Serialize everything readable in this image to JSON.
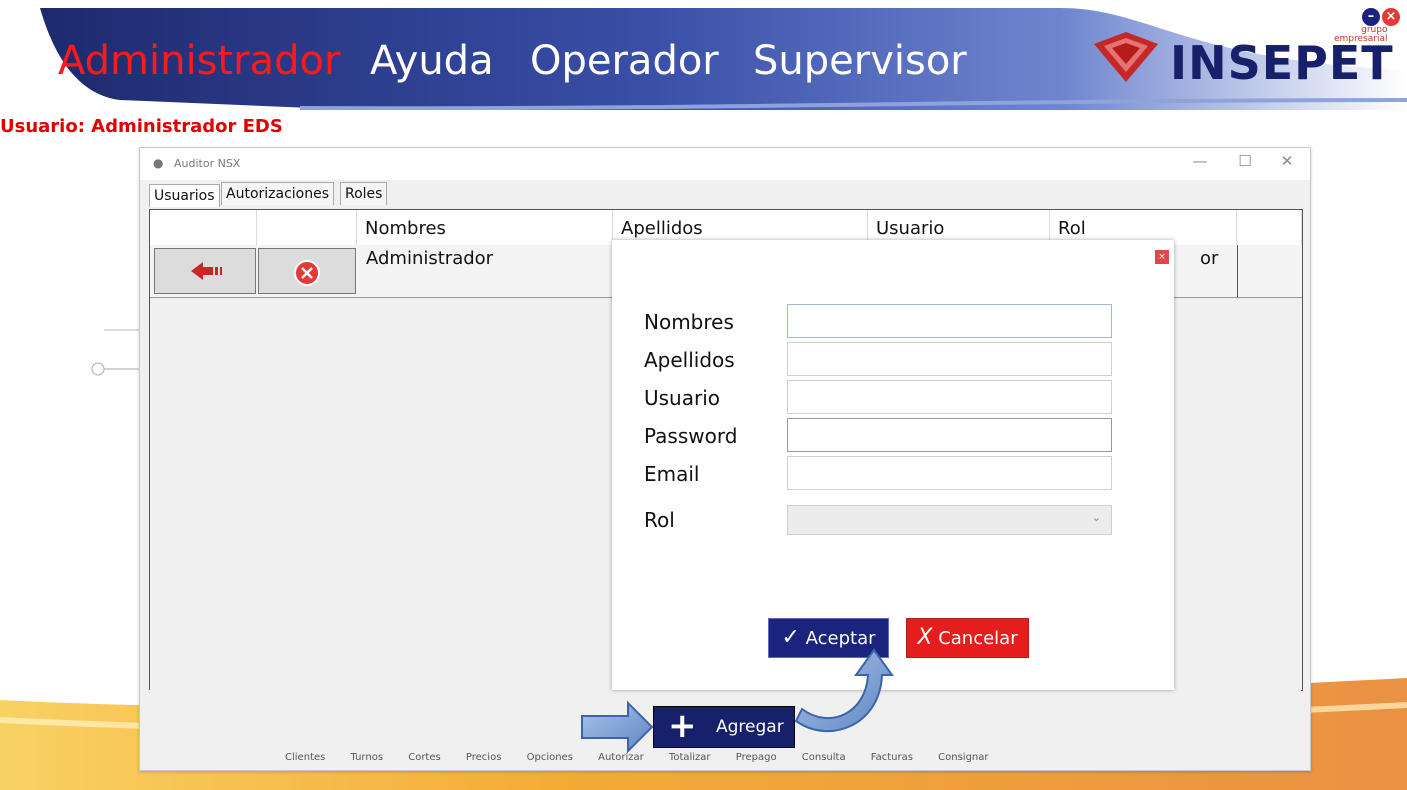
{
  "banner": {
    "menu": [
      "Administrador",
      "Ayuda",
      "Operador",
      "Supervisor"
    ],
    "logo_text": "INSEPET",
    "logo_sub_1": "grupo",
    "logo_sub_2": "empresarial"
  },
  "user_label": "Usuario: Administrador EDS",
  "window": {
    "title": "Auditor NSX",
    "tabs": [
      "Usuarios",
      "Autorizaciones",
      "Roles"
    ],
    "grid": {
      "columns": [
        "",
        "",
        "Nombres",
        "Apellidos",
        "Usuario",
        "Rol"
      ],
      "row": {
        "nombres": "Administrador",
        "rol_partial": "or"
      }
    }
  },
  "dialog": {
    "fields": [
      {
        "label": "Nombres",
        "value": "",
        "placeholder": ""
      },
      {
        "label": "Apellidos",
        "value": "",
        "placeholder": ""
      },
      {
        "label": "Usuario",
        "value": "",
        "placeholder": ""
      },
      {
        "label": "Password",
        "value": "",
        "placeholder": ""
      },
      {
        "label": "Email",
        "value": "",
        "placeholder": ""
      }
    ],
    "rol_label": "Rol",
    "rol_selected": "",
    "accept_label": "Aceptar",
    "cancel_label": "Cancelar"
  },
  "add_button_label": "Agregar",
  "bottom_nav": [
    "Clientes",
    "Turnos",
    "Cortes",
    "Precios",
    "Opciones",
    "Autorizar",
    "Totalizar",
    "Prepago",
    "Consulta",
    "Facturas",
    "Consignar"
  ],
  "colors": {
    "brand_navy": "#16206b",
    "accent_red": "#e51d1d",
    "banner_blue": "#2a3a8c"
  }
}
